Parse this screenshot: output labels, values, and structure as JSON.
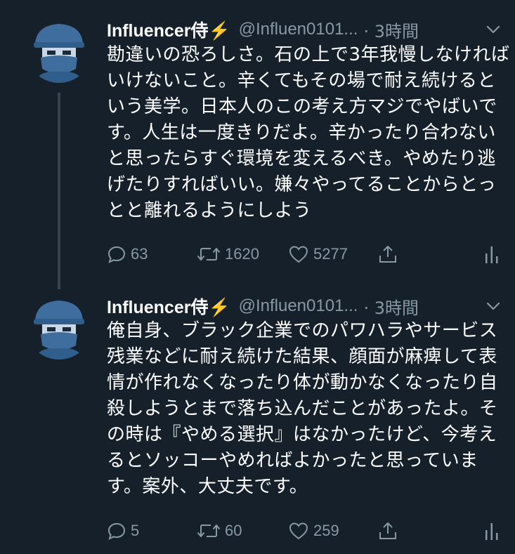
{
  "tweets": [
    {
      "name": "Influencer侍⚡",
      "handle": "@Influen0101...",
      "time": "· 3時間",
      "text": "勘違いの恐ろしさ。石の上で3年我慢しなければいけないこと。辛くてもその場で耐え続けるという美学。日本人のこの考え方マジでやばいです。人生は一度きりだよ。辛かったり合わないと思ったらすぐ環境を変えるべき。やめたり逃げたりすればいい。嫌々やってることからとっとと離れるようにしよう",
      "replies": "63",
      "retweets": "1620",
      "likes": "5277"
    },
    {
      "name": "Influencer侍⚡",
      "handle": "@Influen0101...",
      "time": "· 3時間",
      "text": "俺自身、ブラック企業でのパワハラやサービス残業などに耐え続けた結果、顔面が麻痺して表情が作れなくなったり体が動かなくなったり自殺しようとまで落ち込んだことがあったよ。その時は『やめる選択』はなかったけど、今考えるとソッコーやめればよかったと思っています。案外、大丈夫です。",
      "replies": "5",
      "retweets": "60",
      "likes": "259"
    }
  ],
  "icons": {
    "caret": "chevron-down-icon",
    "reply": "reply-icon",
    "retweet": "retweet-icon",
    "like": "heart-icon",
    "share": "share-icon",
    "analytics": "analytics-icon",
    "avatar": "samurai-avatar"
  },
  "colors": {
    "background": "#15202b",
    "text": "#ffffff",
    "secondary": "#8899a6",
    "thread_line": "#38444d",
    "avatar_blue": "#3f6e9e"
  }
}
